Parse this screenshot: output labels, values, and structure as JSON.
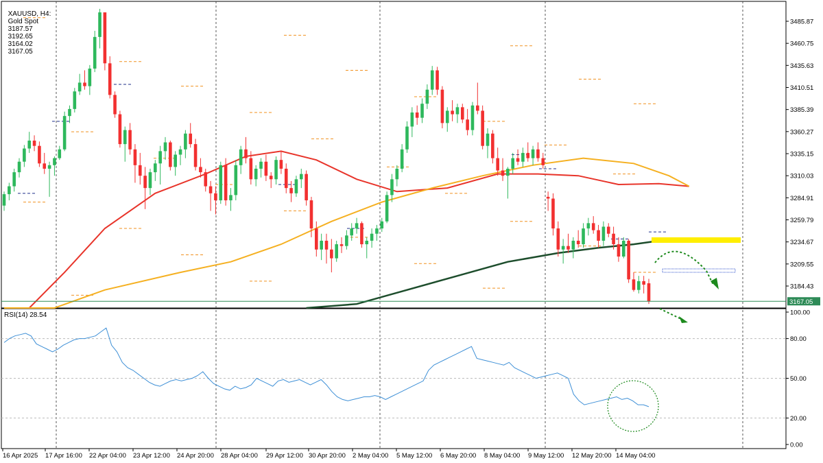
{
  "header": {
    "symbol": "XAUUSD, H4:",
    "description": "Gold Spot",
    "open": "3187.57",
    "high": "3192.65",
    "low": "3164.02",
    "close": "3167.05"
  },
  "rsi_header": "RSI(14) 28.54",
  "current_price_label": "3167.05",
  "colors": {
    "bull": "#2eb85c",
    "bear": "#f23030",
    "ma_fast": "#e8342a",
    "ma_mid": "#f5b021",
    "ma_slow": "#1d4d2c",
    "rsi": "#3d8fd6",
    "highlight": "#ffee00",
    "annotation": "#1d8a1d",
    "level_orange": "#f0901e",
    "level_navy": "#1f2d8a"
  },
  "chart_data": [
    {
      "type": "candlestick",
      "title": "XAUUSD, H4: Gold Spot",
      "ylim": [
        3150,
        3510
      ],
      "y_ticks": [
        "3485.87",
        "3460.75",
        "3435.63",
        "3410.51",
        "3385.39",
        "3360.27",
        "3335.15",
        "3310.03",
        "3284.91",
        "3259.79",
        "3234.67",
        "3209.55",
        "3184.43"
      ],
      "x_ticks": [
        "16 Apr 2025",
        "17 Apr 16:00",
        "22 Apr 04:00",
        "23 Apr 12:00",
        "24 Apr 20:00",
        "28 Apr 04:00",
        "29 Apr 12:00",
        "30 Apr 20:00",
        "2 May 04:00",
        "5 May 12:00",
        "6 May 20:00",
        "8 May 04:00",
        "9 May 12:00",
        "12 May 20:00",
        "14 May 04:00"
      ],
      "candles": [
        [
          3276,
          3292,
          3270,
          3289
        ],
        [
          3289,
          3302,
          3282,
          3298
        ],
        [
          3298,
          3318,
          3292,
          3314
        ],
        [
          3314,
          3330,
          3308,
          3326
        ],
        [
          3326,
          3345,
          3320,
          3341
        ],
        [
          3341,
          3360,
          3336,
          3350
        ],
        [
          3350,
          3356,
          3338,
          3344
        ],
        [
          3344,
          3349,
          3320,
          3324
        ],
        [
          3324,
          3336,
          3312,
          3318
        ],
        [
          3318,
          3326,
          3286,
          3322
        ],
        [
          3322,
          3332,
          3310,
          3330
        ],
        [
          3330,
          3344,
          3328,
          3340
        ],
        [
          3340,
          3383,
          3338,
          3378
        ],
        [
          3378,
          3390,
          3370,
          3386
        ],
        [
          3386,
          3410,
          3382,
          3406
        ],
        [
          3406,
          3426,
          3402,
          3416
        ],
        [
          3416,
          3430,
          3408,
          3412
        ],
        [
          3412,
          3436,
          3402,
          3432
        ],
        [
          3432,
          3475,
          3428,
          3468
        ],
        [
          3468,
          3500,
          3455,
          3496
        ],
        [
          3496,
          3488,
          3430,
          3438
        ],
        [
          3438,
          3446,
          3398,
          3402
        ],
        [
          3402,
          3406,
          3376,
          3380
        ],
        [
          3380,
          3384,
          3342,
          3346
        ],
        [
          3346,
          3366,
          3326,
          3362
        ],
        [
          3362,
          3370,
          3334,
          3340
        ],
        [
          3340,
          3346,
          3302,
          3322
        ],
        [
          3322,
          3336,
          3300,
          3310
        ],
        [
          3310,
          3320,
          3272,
          3296
        ],
        [
          3296,
          3318,
          3288,
          3314
        ],
        [
          3314,
          3328,
          3304,
          3324
        ],
        [
          3324,
          3344,
          3300,
          3338
        ],
        [
          3338,
          3354,
          3328,
          3348
        ],
        [
          3348,
          3350,
          3316,
          3320
        ],
        [
          3320,
          3338,
          3310,
          3334
        ],
        [
          3334,
          3344,
          3322,
          3340
        ],
        [
          3340,
          3362,
          3330,
          3358
        ],
        [
          3358,
          3370,
          3342,
          3346
        ],
        [
          3346,
          3352,
          3316,
          3320
        ],
        [
          3320,
          3330,
          3308,
          3314
        ],
        [
          3314,
          3318,
          3292,
          3298
        ],
        [
          3298,
          3304,
          3270,
          3290
        ],
        [
          3290,
          3298,
          3266,
          3282
        ],
        [
          3282,
          3326,
          3278,
          3322
        ],
        [
          3322,
          3330,
          3276,
          3282
        ],
        [
          3282,
          3296,
          3270,
          3288
        ],
        [
          3288,
          3328,
          3282,
          3322
        ],
        [
          3322,
          3344,
          3312,
          3340
        ],
        [
          3340,
          3354,
          3324,
          3330
        ],
        [
          3330,
          3338,
          3300,
          3306
        ],
        [
          3306,
          3322,
          3298,
          3318
        ],
        [
          3318,
          3330,
          3308,
          3326
        ],
        [
          3326,
          3334,
          3304,
          3310
        ],
        [
          3310,
          3314,
          3296,
          3306
        ],
        [
          3306,
          3332,
          3300,
          3328
        ],
        [
          3328,
          3338,
          3312,
          3318
        ],
        [
          3318,
          3324,
          3290,
          3296
        ],
        [
          3296,
          3304,
          3280,
          3290
        ],
        [
          3290,
          3310,
          3286,
          3306
        ],
        [
          3306,
          3318,
          3296,
          3312
        ],
        [
          3312,
          3316,
          3276,
          3282
        ],
        [
          3282,
          3286,
          3240,
          3250
        ],
        [
          3250,
          3258,
          3218,
          3226
        ],
        [
          3226,
          3244,
          3214,
          3236
        ],
        [
          3236,
          3244,
          3210,
          3226
        ],
        [
          3226,
          3238,
          3200,
          3216
        ],
        [
          3216,
          3236,
          3212,
          3232
        ],
        [
          3232,
          3240,
          3222,
          3230
        ],
        [
          3230,
          3248,
          3226,
          3242
        ],
        [
          3242,
          3256,
          3236,
          3250
        ],
        [
          3250,
          3262,
          3244,
          3256
        ],
        [
          3256,
          3258,
          3228,
          3232
        ],
        [
          3232,
          3240,
          3216,
          3236
        ],
        [
          3236,
          3250,
          3228,
          3244
        ],
        [
          3244,
          3254,
          3236,
          3250
        ],
        [
          3250,
          3262,
          3246,
          3258
        ],
        [
          3258,
          3292,
          3256,
          3288
        ],
        [
          3288,
          3312,
          3280,
          3306
        ],
        [
          3306,
          3322,
          3298,
          3318
        ],
        [
          3318,
          3346,
          3314,
          3340
        ],
        [
          3340,
          3372,
          3336,
          3366
        ],
        [
          3366,
          3388,
          3354,
          3382
        ],
        [
          3382,
          3390,
          3368,
          3376
        ],
        [
          3376,
          3398,
          3370,
          3392
        ],
        [
          3392,
          3414,
          3386,
          3408
        ],
        [
          3408,
          3435,
          3402,
          3430
        ],
        [
          3430,
          3434,
          3402,
          3408
        ],
        [
          3408,
          3412,
          3364,
          3370
        ],
        [
          3370,
          3388,
          3360,
          3384
        ],
        [
          3384,
          3396,
          3372,
          3380
        ],
        [
          3380,
          3392,
          3370,
          3388
        ],
        [
          3388,
          3392,
          3370,
          3374
        ],
        [
          3374,
          3386,
          3356,
          3362
        ],
        [
          3362,
          3394,
          3356,
          3390
        ],
        [
          3390,
          3416,
          3380,
          3384
        ],
        [
          3384,
          3390,
          3340,
          3344
        ],
        [
          3344,
          3364,
          3330,
          3358
        ],
        [
          3358,
          3362,
          3324,
          3330
        ],
        [
          3330,
          3342,
          3310,
          3316
        ],
        [
          3316,
          3330,
          3304,
          3310
        ],
        [
          3310,
          3320,
          3284,
          3318
        ],
        [
          3318,
          3336,
          3312,
          3330
        ],
        [
          3330,
          3340,
          3322,
          3326
        ],
        [
          3326,
          3342,
          3320,
          3336
        ],
        [
          3336,
          3348,
          3326,
          3330
        ],
        [
          3330,
          3344,
          3322,
          3340
        ],
        [
          3340,
          3348,
          3326,
          3330
        ],
        [
          3330,
          3336,
          3318,
          3322
        ],
        [
          3286,
          3292,
          3270,
          3284
        ],
        [
          3284,
          3290,
          3242,
          3250
        ],
        [
          3250,
          3258,
          3218,
          3226
        ],
        [
          3226,
          3238,
          3210,
          3230
        ],
        [
          3230,
          3244,
          3222,
          3226
        ],
        [
          3226,
          3240,
          3216,
          3236
        ],
        [
          3236,
          3248,
          3228,
          3232
        ],
        [
          3232,
          3256,
          3228,
          3250
        ],
        [
          3250,
          3262,
          3242,
          3256
        ],
        [
          3256,
          3264,
          3244,
          3248
        ],
        [
          3248,
          3254,
          3228,
          3236
        ],
        [
          3236,
          3258,
          3230,
          3252
        ],
        [
          3252,
          3256,
          3240,
          3244
        ],
        [
          3244,
          3252,
          3226,
          3232
        ],
        [
          3232,
          3240,
          3212,
          3218
        ],
        [
          3218,
          3240,
          3216,
          3236
        ],
        [
          3236,
          3238,
          3188,
          3192
        ],
        [
          3192,
          3200,
          3178,
          3180
        ],
        [
          3180,
          3196,
          3176,
          3190
        ],
        [
          3190,
          3196,
          3176,
          3186
        ],
        [
          3187.57,
          3192.65,
          3164.02,
          3167.05
        ]
      ],
      "moving_averages": [
        {
          "color": "#e8342a",
          "points": [
            [
              0,
              3133
            ],
            [
              5,
              3150
            ],
            [
              12,
              3200
            ],
            [
              20,
              3250
            ],
            [
              30,
              3290
            ],
            [
              40,
              3312
            ],
            [
              48,
              3332
            ],
            [
              55,
              3338
            ],
            [
              62,
              3328
            ],
            [
              70,
              3306
            ],
            [
              78,
              3292
            ],
            [
              88,
              3296
            ],
            [
              98,
              3312
            ],
            [
              106,
              3312
            ],
            [
              114,
              3310
            ],
            [
              122,
              3300
            ],
            [
              130,
              3301
            ],
            [
              136,
              3298
            ]
          ]
        },
        {
          "color": "#f5b021",
          "points": [
            [
              0,
              3118
            ],
            [
              10,
              3155
            ],
            [
              20,
              3180
            ],
            [
              35,
              3200
            ],
            [
              45,
              3212
            ],
            [
              55,
              3232
            ],
            [
              65,
              3258
            ],
            [
              75,
              3280
            ],
            [
              85,
              3296
            ],
            [
              95,
              3310
            ],
            [
              105,
              3322
            ],
            [
              115,
              3330
            ],
            [
              125,
              3324
            ],
            [
              132,
              3310
            ],
            [
              136,
              3298
            ]
          ]
        },
        {
          "color": "#1d4d2c",
          "points": [
            [
              60,
              3146
            ],
            [
              70,
              3164
            ],
            [
              80,
              3180
            ],
            [
              90,
              3196
            ],
            [
              100,
              3212
            ],
            [
              110,
              3222
            ],
            [
              118,
              3228
            ],
            [
              125,
              3232
            ],
            [
              130,
              3236
            ],
            [
              136,
              3238
            ]
          ]
        }
      ],
      "horizontal_levels_orange": [
        3490,
        3470,
        3458,
        3440,
        3430,
        3420,
        3412,
        3400,
        3392,
        3382,
        3372,
        3360,
        3352,
        3345,
        3330,
        3320,
        3312,
        3300,
        3290,
        3280,
        3270,
        3258,
        3250,
        3240,
        3230,
        3220,
        3210,
        3200,
        3190,
        3182,
        3174
      ],
      "horizontal_levels_navy": [
        3414,
        3372,
        3334,
        3318,
        3300,
        3290,
        3250,
        3246,
        3238
      ]
    },
    {
      "type": "line",
      "title": "RSI(14) 28.54",
      "ylim": [
        0,
        100
      ],
      "y_ticks": [
        "100.00",
        "80.00",
        "50.00",
        "20.00",
        "0.00"
      ],
      "series": [
        {
          "values": [
            77,
            80,
            82,
            83,
            84,
            82,
            76,
            74,
            72,
            70,
            72,
            75,
            77,
            79,
            80,
            80,
            81,
            82,
            85,
            88,
            75,
            70,
            62,
            58,
            56,
            53,
            50,
            47,
            45,
            44,
            46,
            48,
            49,
            48,
            49,
            50,
            52,
            55,
            50,
            46,
            44,
            42,
            41,
            44,
            42,
            43,
            45,
            50,
            48,
            46,
            44,
            48,
            49,
            47,
            48,
            49,
            47,
            45,
            47,
            49,
            45,
            40,
            36,
            34,
            33,
            34,
            35,
            36,
            36,
            37,
            36,
            34,
            36,
            38,
            40,
            42,
            44,
            46,
            48,
            56,
            60,
            62,
            64,
            66,
            68,
            70,
            72,
            74,
            65,
            64,
            63,
            62,
            61,
            60,
            62,
            58,
            56,
            54,
            52,
            50,
            51,
            52,
            53,
            54,
            52,
            50,
            38,
            33,
            30,
            31,
            32,
            33,
            34,
            35,
            36,
            34,
            35,
            33,
            30,
            30,
            28.54
          ]
        }
      ]
    }
  ]
}
